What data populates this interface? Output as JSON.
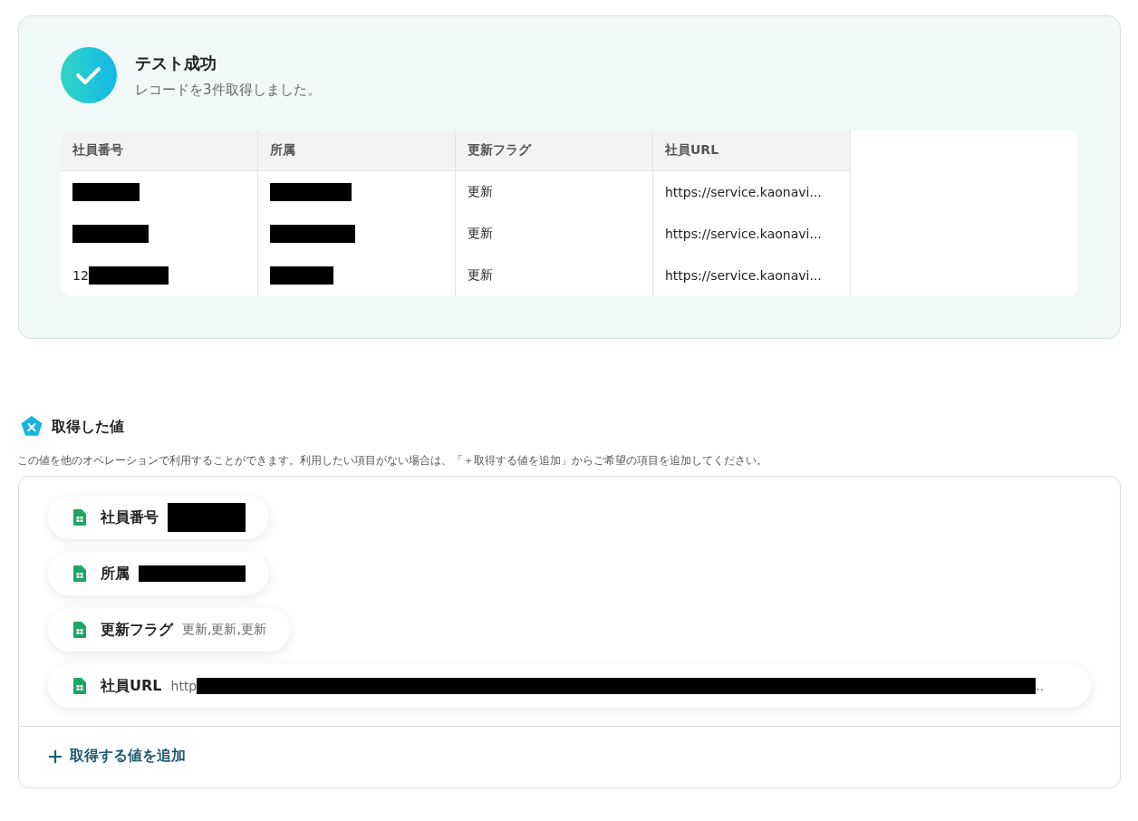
{
  "test_result": {
    "title": "テスト成功",
    "message": "レコードを3件取得しました。",
    "table": {
      "columns": [
        "社員番号",
        "所属",
        "更新フラグ",
        "社員URL"
      ],
      "rows": [
        [
          {
            "redacted": true
          },
          {
            "redacted": true
          },
          {
            "text": "更新",
            "redacted": false
          },
          {
            "text": "https://service.kaonavi...",
            "redacted": false
          }
        ],
        [
          {
            "redacted": true
          },
          {
            "redacted": true
          },
          {
            "text": "更新",
            "redacted": false
          },
          {
            "text": "https://service.kaonavi...",
            "redacted": false
          }
        ],
        [
          {
            "text": "12",
            "redacted": true
          },
          {
            "redacted": true
          },
          {
            "text": "更新",
            "redacted": false
          },
          {
            "text": "https://service.kaonavi...",
            "redacted": false
          }
        ]
      ]
    }
  },
  "fetched_values": {
    "title": "取得した値",
    "description": "この値を他のオペレーションで利用することができます。利用したい項目がない場合は、「＋取得する値を追加」からご希望の項目を追加してください。",
    "items": [
      {
        "label": "社員番号",
        "redacted": true
      },
      {
        "label": "所属",
        "redacted": true
      },
      {
        "label": "更新フラグ",
        "value": "更新,更新,更新",
        "redacted": false
      },
      {
        "label": "社員URL",
        "value": "http",
        "redacted": true,
        "trail": ".."
      }
    ],
    "add_button": "取得する値を追加"
  }
}
